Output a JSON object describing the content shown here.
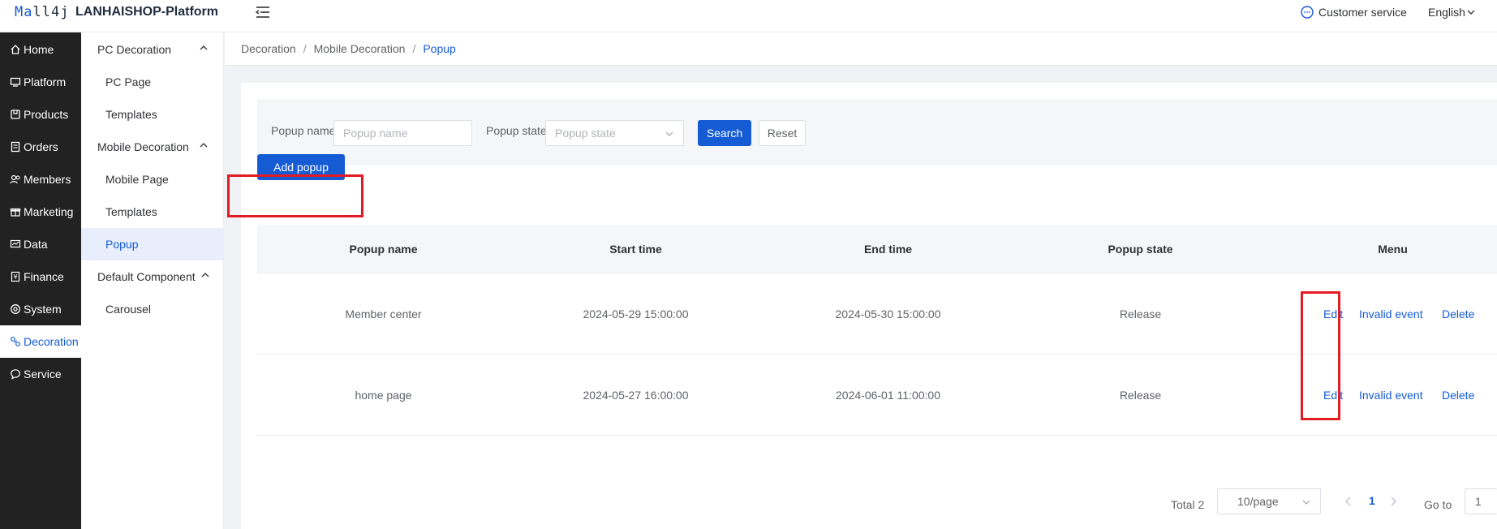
{
  "header": {
    "logo_prefix": "Ma",
    "logo_suffix": "ll4j",
    "app_title": "LANHAISHOP-Platform",
    "customer_service": "Customer service",
    "language": "English"
  },
  "sidebar": {
    "items": [
      {
        "label": "Home",
        "icon": "home-icon"
      },
      {
        "label": "Platform",
        "icon": "monitor-icon"
      },
      {
        "label": "Products",
        "icon": "box-icon"
      },
      {
        "label": "Orders",
        "icon": "document-icon"
      },
      {
        "label": "Members",
        "icon": "members-icon"
      },
      {
        "label": "Marketing",
        "icon": "gift-icon"
      },
      {
        "label": "Data",
        "icon": "chart-icon"
      },
      {
        "label": "Finance",
        "icon": "finance-icon"
      },
      {
        "label": "System",
        "icon": "gear-icon"
      },
      {
        "label": "Decoration",
        "icon": "brush-icon",
        "active": true
      },
      {
        "label": "Service",
        "icon": "chat-icon"
      }
    ]
  },
  "submenu": {
    "groups": [
      {
        "label": "PC Decoration",
        "items": [
          "PC Page",
          "Templates"
        ]
      },
      {
        "label": "Mobile Decoration",
        "items": [
          "Mobile Page",
          "Templates",
          "Popup"
        ]
      },
      {
        "label": "Default Component",
        "items": [
          "Carousel"
        ]
      }
    ],
    "active": "Popup"
  },
  "breadcrumb": {
    "items": [
      "Decoration",
      "Mobile Decoration",
      "Popup"
    ],
    "separator": "/"
  },
  "search": {
    "name_label": "Popup name",
    "name_placeholder": "Popup name",
    "state_label": "Popup state",
    "state_placeholder": "Popup state",
    "search_button": "Search",
    "reset_button": "Reset"
  },
  "actions": {
    "add_button": "Add popup"
  },
  "table": {
    "columns": [
      "Popup name",
      "Start time",
      "End time",
      "Popup state",
      "Menu"
    ],
    "rows": [
      {
        "name": "Member center",
        "start": "2024-05-29 15:00:00",
        "end": "2024-05-30 15:00:00",
        "state": "Release",
        "actions": [
          "Edit",
          "Invalid event",
          "Delete"
        ]
      },
      {
        "name": "home page",
        "start": "2024-05-27 16:00:00",
        "end": "2024-06-01 11:00:00",
        "state": "Release",
        "actions": [
          "Edit",
          "Invalid event",
          "Delete"
        ]
      }
    ]
  },
  "pagination": {
    "total_text": "Total 2",
    "page_size": "10/page",
    "current_page": "1",
    "goto_label": "Go to",
    "goto_value": "1"
  },
  "colors": {
    "primary": "#155bd4",
    "sidebar_bg": "#222222",
    "highlight": "#e11c22"
  }
}
